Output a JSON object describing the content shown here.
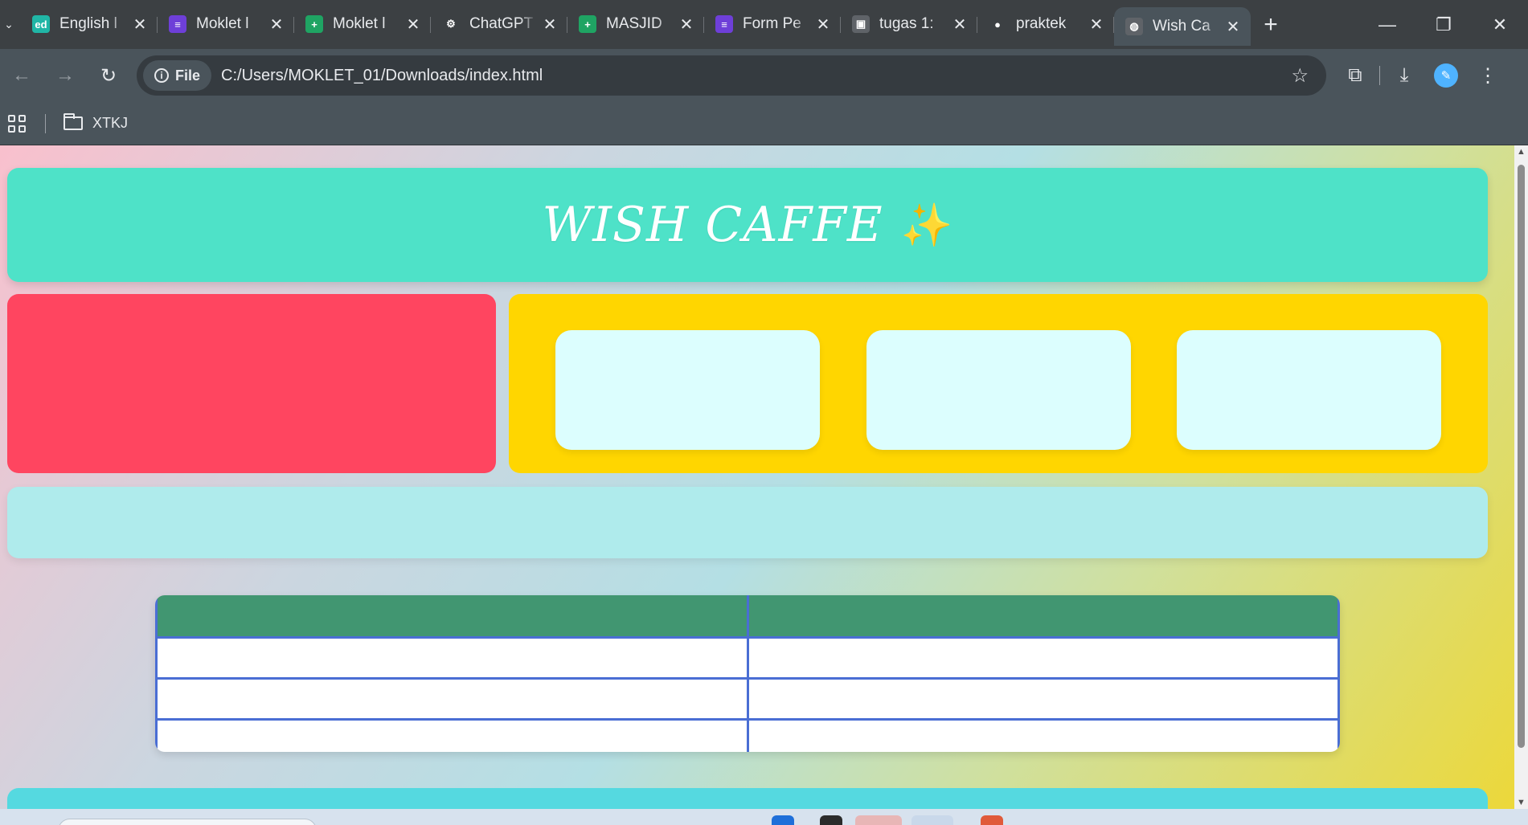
{
  "browser": {
    "tabs": [
      {
        "title": "English l",
        "favicon": "ed-icon",
        "fav_text": "ed",
        "color": "#20b6a6"
      },
      {
        "title": "Moklet l",
        "favicon": "forms-icon",
        "fav_text": "≡",
        "color": "#6e3fd8"
      },
      {
        "title": "Moklet l",
        "favicon": "sheets-icon",
        "fav_text": "+",
        "color": "#1fa463"
      },
      {
        "title": "ChatGPT",
        "favicon": "openai-icon",
        "fav_text": "⚙",
        "color": "#3c4043"
      },
      {
        "title": "MASJID",
        "favicon": "sheets-icon",
        "fav_text": "+",
        "color": "#1fa463"
      },
      {
        "title": "Form Pe",
        "favicon": "forms-icon",
        "fav_text": "≡",
        "color": "#6e3fd8"
      },
      {
        "title": "tugas 1:",
        "favicon": "classroom-icon",
        "fav_text": "▣",
        "color": "#5f6368"
      },
      {
        "title": "praktek",
        "favicon": "github-icon",
        "fav_text": "●",
        "color": "#3c4043"
      },
      {
        "title": "Wish Ca",
        "favicon": "globe-icon",
        "fav_text": "◍",
        "color": "#5f6368",
        "active": true
      }
    ],
    "new_tab": "+",
    "controls": {
      "minimize": "—",
      "restore": "❐",
      "close": "✕"
    },
    "address": {
      "chip_label": "File",
      "url": "C:/Users/MOKLET_01/Downloads/index.html"
    },
    "bookmarks": [
      {
        "label": "XTKJ",
        "icon": "folder-icon"
      }
    ]
  },
  "page": {
    "header": {
      "title": "WISH CAFFE",
      "emoji": "✨"
    },
    "colors": {
      "header": "#4ee2c8",
      "left_panel": "#ff4560",
      "right_panel": "#ffd600",
      "card": "#dcfefe",
      "strip": "#afebec",
      "table_head": "#419671",
      "table_border": "#4a6ed4",
      "footer": "#55d9e0"
    },
    "cards": [
      "",
      "",
      ""
    ],
    "table": {
      "headers": [
        "",
        ""
      ],
      "rows": [
        [
          "",
          ""
        ],
        [
          "",
          ""
        ],
        [
          "",
          ""
        ]
      ]
    }
  }
}
